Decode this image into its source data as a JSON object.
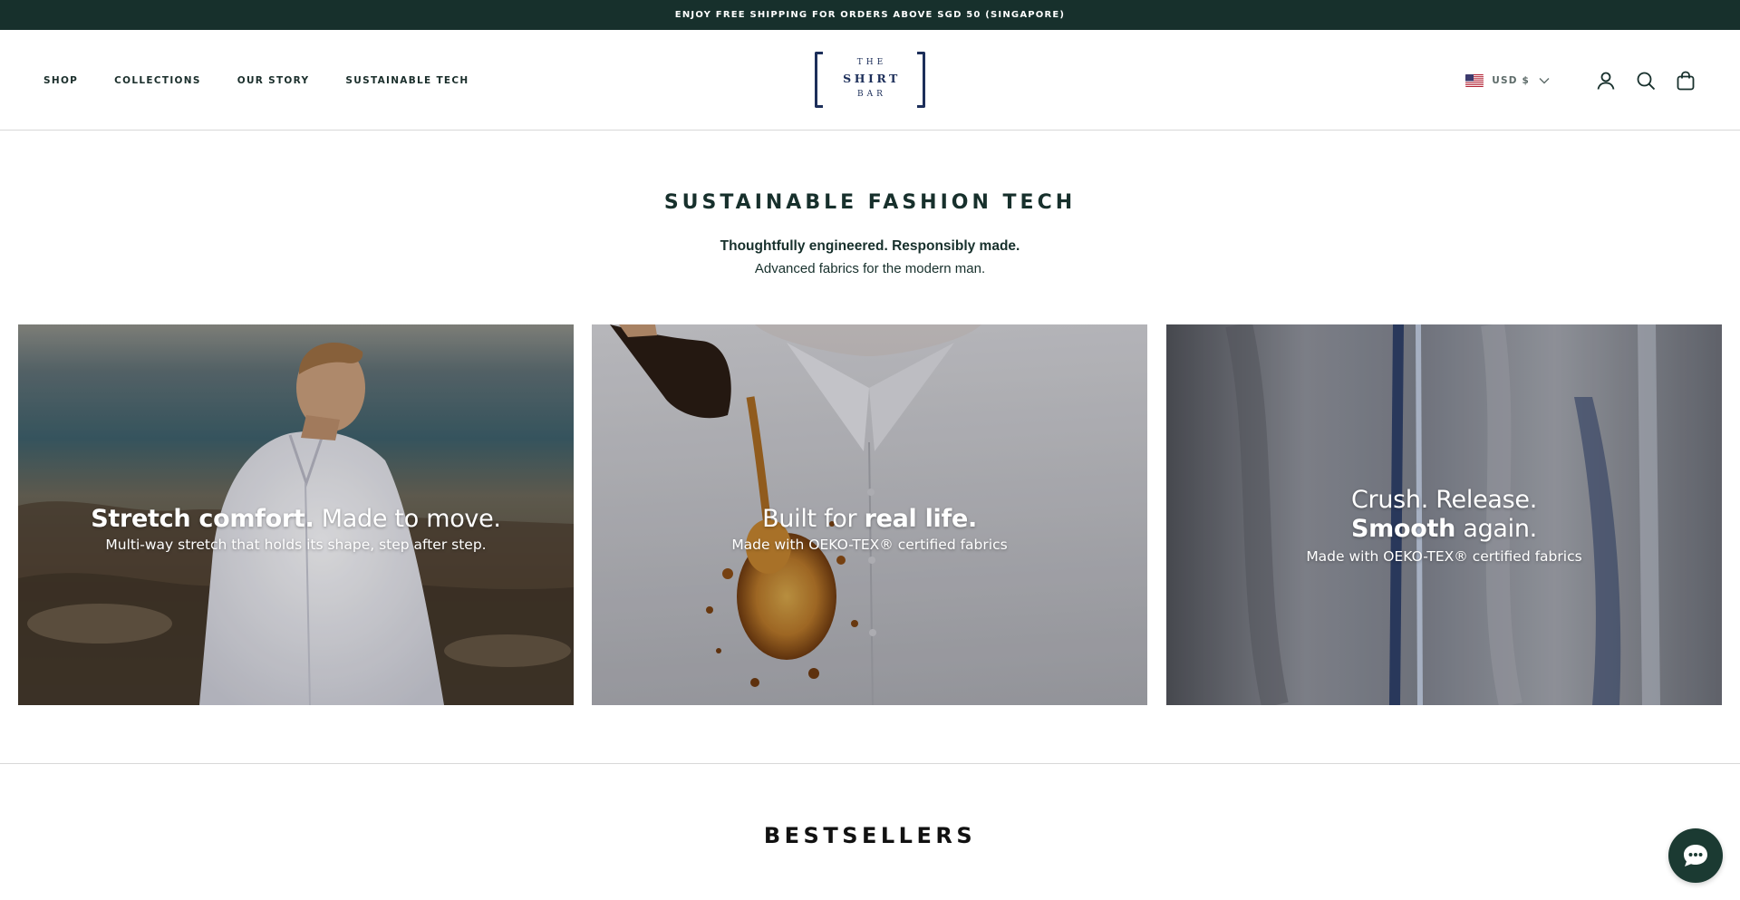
{
  "announcement": {
    "text": "ENJOY FREE SHIPPING FOR ORDERS ABOVE SGD 50 (SINGAPORE)"
  },
  "nav": {
    "items": [
      {
        "label": "SHOP"
      },
      {
        "label": "COLLECTIONS"
      },
      {
        "label": "OUR STORY"
      },
      {
        "label": "SUSTAINABLE TECH"
      }
    ]
  },
  "logo": {
    "line1": "THE",
    "line2": "SHIRT",
    "line3": "BAR"
  },
  "header": {
    "currency_label": "USD $",
    "icons": [
      "us-flag-icon",
      "chevron-down-icon",
      "account-icon",
      "search-icon",
      "bag-icon"
    ]
  },
  "intro": {
    "title": "SUSTAINABLE FASHION TECH",
    "tagline": "Thoughtfully engineered. Responsibly made.",
    "subtitle": "Advanced fabrics for the modern man."
  },
  "cards": [
    {
      "headline_bold": "Stretch comfort.",
      "headline_regular": " Made to move.",
      "subtext": "Multi-way stretch that holds its shape, step after step."
    },
    {
      "headline_regular": "Built for ",
      "headline_bold": "real life.",
      "subtext": "Made with OEKO-TEX® certified fabrics"
    },
    {
      "headline_line1": "Crush. Release.",
      "headline_bold": "Smooth",
      "headline_regular": " again.",
      "subtext": "Made with OEKO-TEX® certified fabrics"
    }
  ],
  "bestsellers": {
    "title": "BESTSELLERS"
  },
  "chat": {
    "icon": "chat-bubble-icon"
  },
  "colors": {
    "announcement_bg": "#17302c",
    "brand_navy": "#1d2f5a",
    "text_dark": "#17302c",
    "chat_bg": "#1b3a32"
  }
}
